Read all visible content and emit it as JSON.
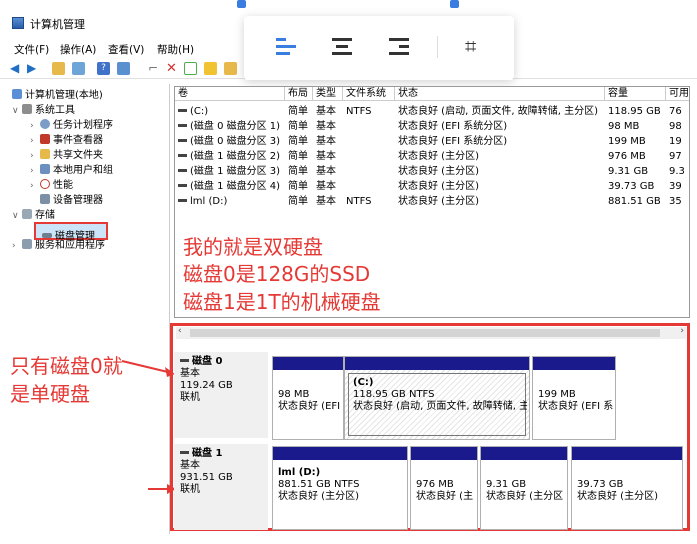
{
  "window": {
    "title": "计算机管理"
  },
  "menu": [
    "文件(F)",
    "操作(A)",
    "查看(V)",
    "帮助(H)"
  ],
  "tree": {
    "root": "计算机管理(本地)",
    "system_tools": "系统工具",
    "task_scheduler": "任务计划程序",
    "event_viewer": "事件查看器",
    "shared_folders": "共享文件夹",
    "local_users": "本地用户和组",
    "performance": "性能",
    "device_manager": "设备管理器",
    "storage": "存储",
    "disk_management": "磁盘管理",
    "services": "服务和应用程序"
  },
  "table": {
    "headers": [
      "卷",
      "布局",
      "类型",
      "文件系统",
      "状态",
      "容量",
      "可用"
    ],
    "rows": [
      [
        "(C:)",
        "简单",
        "基本",
        "NTFS",
        "状态良好 (启动, 页面文件, 故障转储, 主分区)",
        "118.95 GB",
        "76"
      ],
      [
        "(磁盘 0 磁盘分区 1)",
        "简单",
        "基本",
        "",
        "状态良好 (EFI 系统分区)",
        "98 MB",
        "98"
      ],
      [
        "(磁盘 0 磁盘分区 3)",
        "简单",
        "基本",
        "",
        "状态良好 (EFI 系统分区)",
        "199 MB",
        "19"
      ],
      [
        "(磁盘 1 磁盘分区 2)",
        "简单",
        "基本",
        "",
        "状态良好 (主分区)",
        "976 MB",
        "97"
      ],
      [
        "(磁盘 1 磁盘分区 3)",
        "简单",
        "基本",
        "",
        "状态良好 (主分区)",
        "9.31 GB",
        "9.3"
      ],
      [
        "(磁盘 1 磁盘分区 4)",
        "简单",
        "基本",
        "",
        "状态良好 (主分区)",
        "39.73 GB",
        "39"
      ],
      [
        "lml (D:)",
        "简单",
        "基本",
        "NTFS",
        "状态良好 (主分区)",
        "881.51 GB",
        "35"
      ]
    ]
  },
  "annotations": {
    "line1": "我的就是双硬盘",
    "line2": "磁盘0是128G的SSD",
    "line3": "磁盘1是1T的机械硬盘",
    "left1": "只有磁盘0就",
    "left2": "是单硬盘"
  },
  "disks": [
    {
      "name": "磁盘 0",
      "type": "基本",
      "size": "119.24 GB",
      "status": "联机",
      "parts": [
        {
          "l1": "98 MB",
          "l2": "状态良好 (EFI"
        },
        {
          "l0": "(C:)",
          "l1": "118.95 GB NTFS",
          "l2": "状态良好 (启动, 页面文件, 故障转储, 主"
        },
        {
          "l1": "199 MB",
          "l2": "状态良好 (EFI 系"
        }
      ]
    },
    {
      "name": "磁盘 1",
      "type": "基本",
      "size": "931.51 GB",
      "status": "联机",
      "parts": [
        {
          "l0": "lml  (D:)",
          "l1": "881.51 GB NTFS",
          "l2": "状态良好 (主分区)"
        },
        {
          "l1": "976 MB",
          "l2": "状态良好 (主"
        },
        {
          "l1": "9.31 GB",
          "l2": "状态良好 (主分区"
        },
        {
          "l1": "39.73 GB",
          "l2": "状态良好 (主分区)"
        }
      ]
    }
  ],
  "colors": {
    "accent": "#e53935",
    "partition_bar": "#1a1a8c",
    "selection": "#cce4f7"
  }
}
